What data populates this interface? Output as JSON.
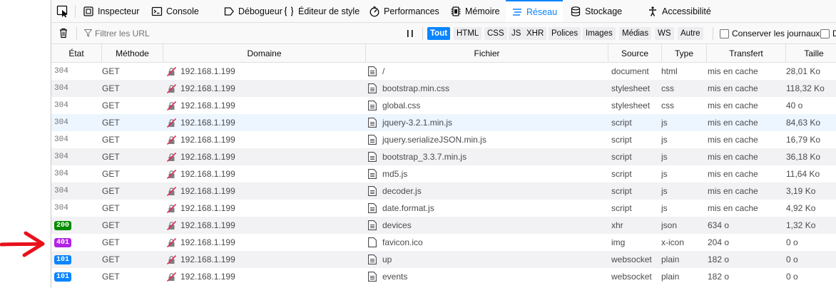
{
  "toolbar": {
    "tabs": [
      {
        "label": "Inspecteur",
        "icon": "inspector-icon",
        "active": false
      },
      {
        "label": "Console",
        "icon": "console-icon",
        "active": false
      },
      {
        "label": "Débogueur",
        "icon": "debugger-icon",
        "active": false
      },
      {
        "label": "Éditeur de style",
        "icon": "style-editor-icon",
        "active": false
      },
      {
        "label": "Performances",
        "icon": "performance-icon",
        "active": false
      },
      {
        "label": "Mémoire",
        "icon": "memory-icon",
        "active": false
      },
      {
        "label": "Réseau",
        "icon": "network-icon",
        "active": true
      },
      {
        "label": "Stockage",
        "icon": "storage-icon",
        "active": false
      },
      {
        "label": "Accessibilité",
        "icon": "accessibility-icon",
        "active": false
      }
    ]
  },
  "filterbar": {
    "placeholder": "Filtrer les URL",
    "types": [
      {
        "label": "Tout",
        "active": true
      },
      {
        "label": "HTML"
      },
      {
        "label": "CSS"
      },
      {
        "label": "JS"
      },
      {
        "label": "XHR"
      },
      {
        "label": "Polices"
      },
      {
        "label": "Images"
      },
      {
        "label": "Médias"
      },
      {
        "label": "WS"
      },
      {
        "label": "Autre"
      }
    ],
    "persist_logs_label": "Conserver les journaux",
    "disable_cache_label": "D"
  },
  "table": {
    "columns": [
      "État",
      "Méthode",
      "Domaine",
      "Fichier",
      "Source",
      "Type",
      "Transfert",
      "Taille"
    ],
    "rows": [
      {
        "status": "304",
        "method": "GET",
        "domain": "192.168.1.199",
        "file": "/",
        "source": "document",
        "type": "html",
        "transfer": "mis en cache",
        "size": "28,01 Ko"
      },
      {
        "status": "304",
        "method": "GET",
        "domain": "192.168.1.199",
        "file": "bootstrap.min.css",
        "source": "stylesheet",
        "type": "css",
        "transfer": "mis en cache",
        "size": "118,32 Ko"
      },
      {
        "status": "304",
        "method": "GET",
        "domain": "192.168.1.199",
        "file": "global.css",
        "source": "stylesheet",
        "type": "css",
        "transfer": "mis en cache",
        "size": "40 o"
      },
      {
        "status": "304",
        "method": "GET",
        "domain": "192.168.1.199",
        "file": "jquery-3.2.1.min.js",
        "source": "script",
        "type": "js",
        "transfer": "mis en cache",
        "size": "84,63 Ko"
      },
      {
        "status": "304",
        "method": "GET",
        "domain": "192.168.1.199",
        "file": "jquery.serializeJSON.min.js",
        "source": "script",
        "type": "js",
        "transfer": "mis en cache",
        "size": "16,79 Ko"
      },
      {
        "status": "304",
        "method": "GET",
        "domain": "192.168.1.199",
        "file": "bootstrap_3.3.7.min.js",
        "source": "script",
        "type": "js",
        "transfer": "mis en cache",
        "size": "36,18 Ko"
      },
      {
        "status": "304",
        "method": "GET",
        "domain": "192.168.1.199",
        "file": "md5.js",
        "source": "script",
        "type": "js",
        "transfer": "mis en cache",
        "size": "11,64 Ko"
      },
      {
        "status": "304",
        "method": "GET",
        "domain": "192.168.1.199",
        "file": "decoder.js",
        "source": "script",
        "type": "js",
        "transfer": "mis en cache",
        "size": "3,19 Ko"
      },
      {
        "status": "304",
        "method": "GET",
        "domain": "192.168.1.199",
        "file": "date.format.js",
        "source": "script",
        "type": "js",
        "transfer": "mis en cache",
        "size": "4,92 Ko"
      },
      {
        "status": "200",
        "method": "GET",
        "domain": "192.168.1.199",
        "file": "devices",
        "source": "xhr",
        "type": "json",
        "transfer": "634 o",
        "size": "1,32 Ko",
        "badge_color": "#058b00"
      },
      {
        "status": "401",
        "method": "GET",
        "domain": "192.168.1.199",
        "file": "favicon.ico",
        "source": "img",
        "type": "x-icon",
        "transfer": "204 o",
        "size": "0 o",
        "badge_color": "#b222e6"
      },
      {
        "status": "101",
        "method": "GET",
        "domain": "192.168.1.199",
        "file": "up",
        "source": "websocket",
        "type": "plain",
        "transfer": "182 o",
        "size": "0 o",
        "badge_color": "#0a84ff"
      },
      {
        "status": "101",
        "method": "GET",
        "domain": "192.168.1.199",
        "file": "events",
        "source": "websocket",
        "type": "plain",
        "transfer": "182 o",
        "size": "0 o",
        "badge_color": "#0a84ff"
      }
    ]
  },
  "colors": {
    "accent": "#0a84ff",
    "annotation_arrow": "#e8111a"
  }
}
